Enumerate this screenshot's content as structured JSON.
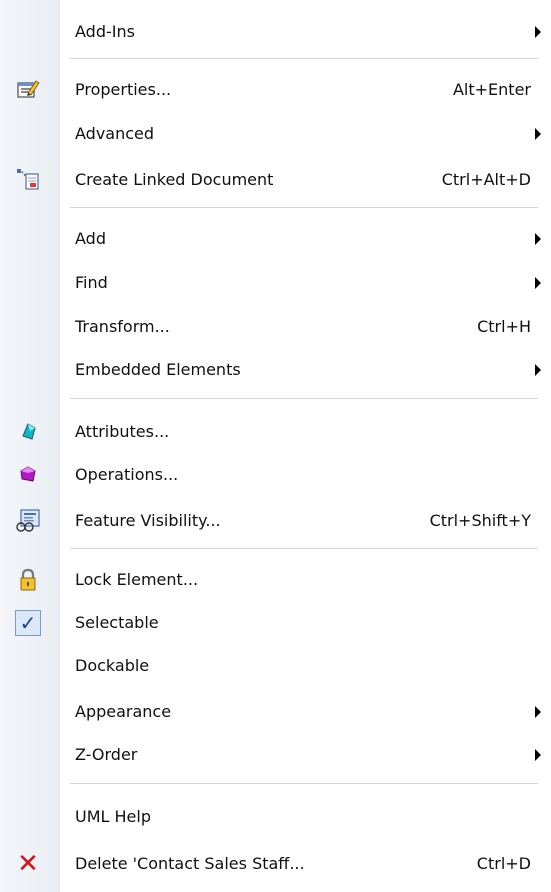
{
  "menu": {
    "items": [
      {
        "label": "Add-Ins",
        "icon": "",
        "shortcut": "",
        "submenu": true
      },
      {
        "label": "Properties...",
        "icon": "properties-icon",
        "shortcut": "Alt+Enter",
        "submenu": false
      },
      {
        "label": "Advanced",
        "icon": "",
        "shortcut": "",
        "submenu": true
      },
      {
        "label": "Create Linked Document",
        "icon": "linked-document-icon",
        "shortcut": "Ctrl+Alt+D",
        "submenu": false
      },
      {
        "label": "Add",
        "icon": "",
        "shortcut": "",
        "submenu": true
      },
      {
        "label": "Find",
        "icon": "",
        "shortcut": "",
        "submenu": true
      },
      {
        "label": "Transform...",
        "icon": "",
        "shortcut": "Ctrl+H",
        "submenu": false
      },
      {
        "label": "Embedded Elements",
        "icon": "",
        "shortcut": "",
        "submenu": true
      },
      {
        "label": "Attributes...",
        "icon": "attribute-icon",
        "shortcut": "",
        "submenu": false
      },
      {
        "label": "Operations...",
        "icon": "operation-icon",
        "shortcut": "",
        "submenu": false
      },
      {
        "label": "Feature Visibility...",
        "icon": "feature-visibility-icon",
        "shortcut": "Ctrl+Shift+Y",
        "submenu": false
      },
      {
        "label": "Lock Element...",
        "icon": "lock-icon",
        "shortcut": "",
        "submenu": false
      },
      {
        "label": "Selectable",
        "icon": "checkmark-icon",
        "shortcut": "",
        "submenu": false,
        "checked": true
      },
      {
        "label": "Dockable",
        "icon": "",
        "shortcut": "",
        "submenu": false
      },
      {
        "label": "Appearance",
        "icon": "",
        "shortcut": "",
        "submenu": true
      },
      {
        "label": "Z-Order",
        "icon": "",
        "shortcut": "",
        "submenu": true
      },
      {
        "label": "UML Help",
        "icon": "",
        "shortcut": "",
        "submenu": false
      },
      {
        "label": "Delete 'Contact Sales Staff...",
        "icon": "delete-icon",
        "shortcut": "Ctrl+D",
        "submenu": false
      }
    ]
  },
  "colors": {
    "gutter": "#e9edf3",
    "separator": "#d4d7dd",
    "text": "#101010",
    "delete": "#d41414",
    "check_background": "#dbe8f8",
    "check_border": "#7a9cc6",
    "attribute_icon": "#16b3c7",
    "operation_icon": "#b416c9"
  }
}
